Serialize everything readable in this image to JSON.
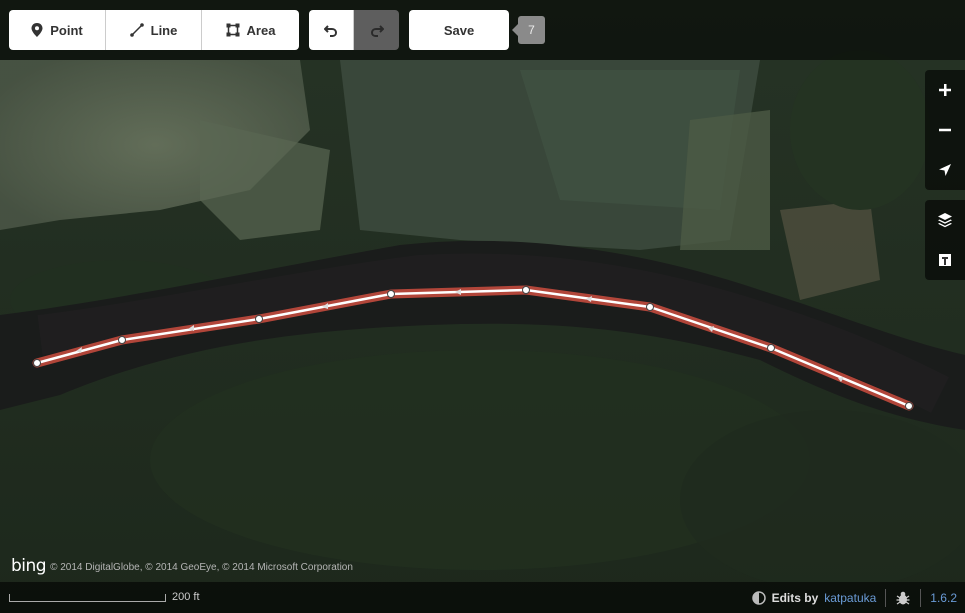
{
  "toolbar": {
    "point_label": "Point",
    "line_label": "Line",
    "area_label": "Area",
    "save_label": "Save",
    "edit_count": "7"
  },
  "icons": {
    "point": "map-pin-icon",
    "line": "line-icon",
    "area": "area-icon",
    "undo": "undo-icon",
    "redo": "redo-icon",
    "zoom_in": "plus-icon",
    "zoom_out": "minus-icon",
    "geolocate": "location-arrow-icon",
    "layers": "layers-icon",
    "map_data": "map-data-icon",
    "help": "bug-icon"
  },
  "attribution": {
    "logo": "bing",
    "text": "© 2014 DigitalGlobe, © 2014 GeoEye, © 2014 Microsoft Corporation"
  },
  "footer": {
    "scale_label": "200 ft",
    "edits_by": "Edits by",
    "edits_user": "katpatuka",
    "version": "1.6.2"
  },
  "colors": {
    "way_casing": "#c24a3d",
    "way_stroke": "#ffffff",
    "link": "#6a9bd6",
    "toolbar_bg": "#000000"
  }
}
